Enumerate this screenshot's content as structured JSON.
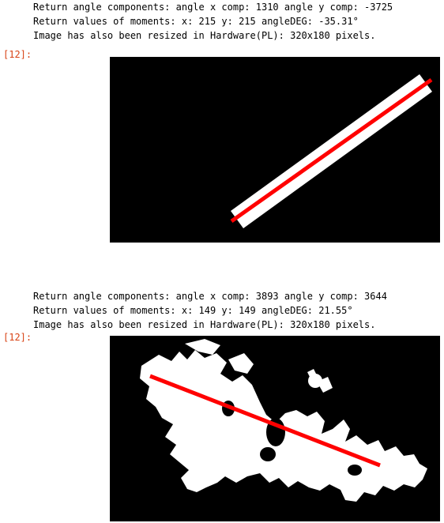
{
  "cells": [
    {
      "output_lines": [
        "Return angle components: angle x comp: 1310 angle y comp: -3725",
        "Return values of moments: x: 215 y: 215 angleDEG: -35.31°",
        "Image has also been resized in Hardware(PL): 320x180 pixels."
      ],
      "prompt": "[12]:",
      "image": {
        "content": "white diagonal bar with red orientation line",
        "background": "#000000",
        "foreground": "#ffffff",
        "line_color": "#ff0000"
      }
    },
    {
      "output_lines": [
        "Return angle components: angle x comp: 3893 angle y comp: 3644",
        "Return values of moments: x: 149 y: 149 angleDEG: 21.55°",
        "Image has also been resized in Hardware(PL): 320x180 pixels."
      ],
      "prompt": "[12]:",
      "image": {
        "content": "white irregular blob with red orientation line",
        "background": "#000000",
        "foreground": "#ffffff",
        "line_color": "#ff0000"
      }
    }
  ]
}
